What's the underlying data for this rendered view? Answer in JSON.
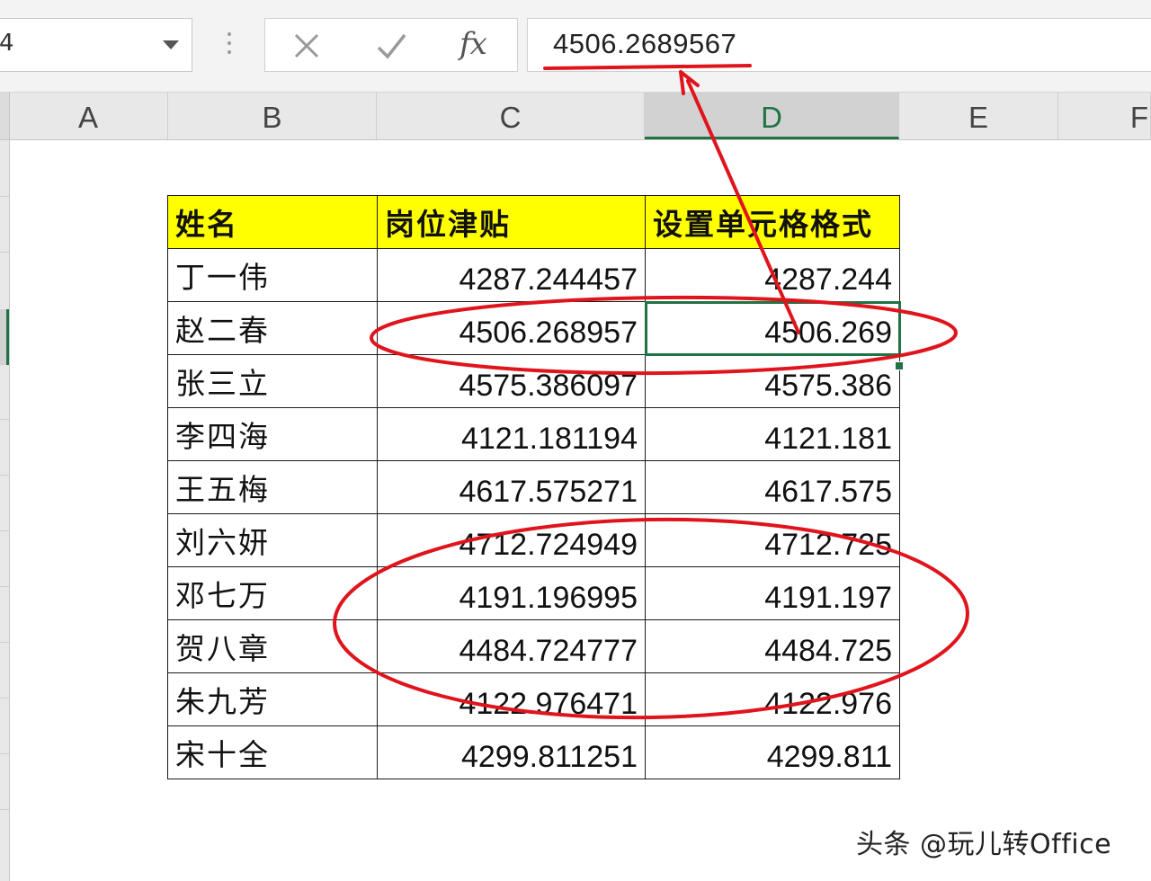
{
  "formula_bar": {
    "name_box_value": "4",
    "cancel_icon": "x-icon",
    "enter_icon": "check-icon",
    "fx_label": "fx",
    "formula_value": "4506.2689567"
  },
  "columns": [
    "A",
    "B",
    "C",
    "D",
    "E",
    "F"
  ],
  "selected_column": "D",
  "table": {
    "headers": [
      "姓名",
      "岗位津贴",
      "设置单元格格式"
    ],
    "header_fill": "#ffff00",
    "rows": [
      {
        "name": "丁一伟",
        "allowance": "4287.244457",
        "formatted": "4287.244"
      },
      {
        "name": "赵二春",
        "allowance": "4506.268957",
        "formatted": "4506.269"
      },
      {
        "name": "张三立",
        "allowance": "4575.386097",
        "formatted": "4575.386"
      },
      {
        "name": "李四海",
        "allowance": "4121.181194",
        "formatted": "4121.181"
      },
      {
        "name": "王五梅",
        "allowance": "4617.575271",
        "formatted": "4617.575"
      },
      {
        "name": "刘六妍",
        "allowance": "4712.724949",
        "formatted": "4712.725"
      },
      {
        "name": "邓七万",
        "allowance": "4191.196995",
        "formatted": "4191.197"
      },
      {
        "name": "贺八章",
        "allowance": "4484.724777",
        "formatted": "4484.725"
      },
      {
        "name": "朱九芳",
        "allowance": "4122.976471",
        "formatted": "4122.976"
      },
      {
        "name": "宋十全",
        "allowance": "4299.811251",
        "formatted": "4299.811"
      }
    ]
  },
  "annotation_color": "#e0141c",
  "accent_color": "#217346",
  "watermark": "头条 @玩儿转Office"
}
